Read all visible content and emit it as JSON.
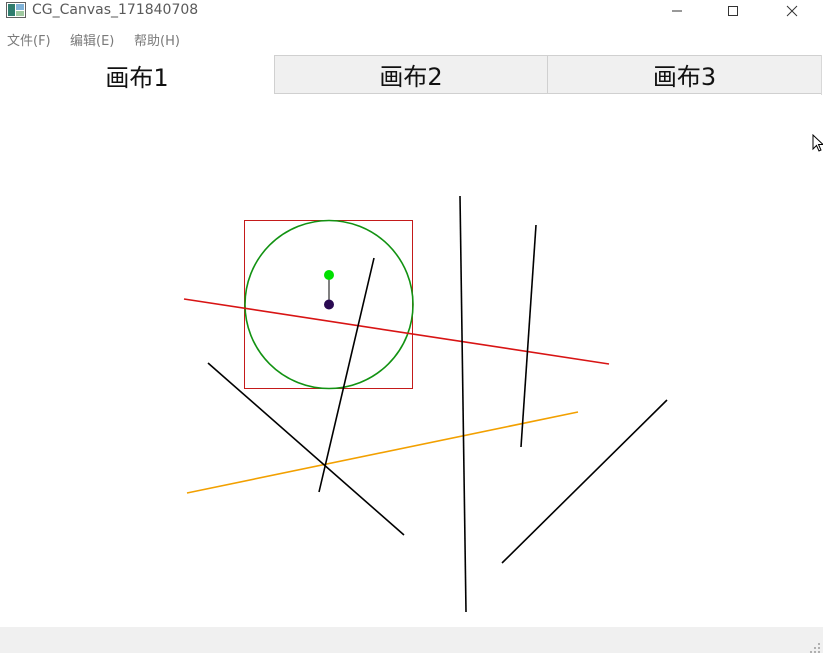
{
  "window": {
    "title": "CG_Canvas_171840708",
    "icons": {
      "app": "app-icon",
      "minimize": "minimize-icon",
      "maximize": "maximize-icon",
      "close": "close-icon"
    }
  },
  "menu": {
    "items": [
      {
        "label": "文件(F)"
      },
      {
        "label": "编辑(E)"
      },
      {
        "label": "帮助(H)"
      }
    ]
  },
  "tabs": [
    {
      "label": "画布1",
      "active": true
    },
    {
      "label": "画布2",
      "active": false
    },
    {
      "label": "画布3",
      "active": false
    }
  ],
  "colors": {
    "red_line": "#d81414",
    "orange_line": "#f2a000",
    "black_line": "#000000",
    "circle": "#129212",
    "selection_box": "#c41a1a",
    "center_handle": "#2a0a52",
    "rotate_handle": "#00e000"
  },
  "status": {
    "grip_icon": "resize-grip-icon",
    "cursor_icon": "mouse-cursor-icon"
  }
}
